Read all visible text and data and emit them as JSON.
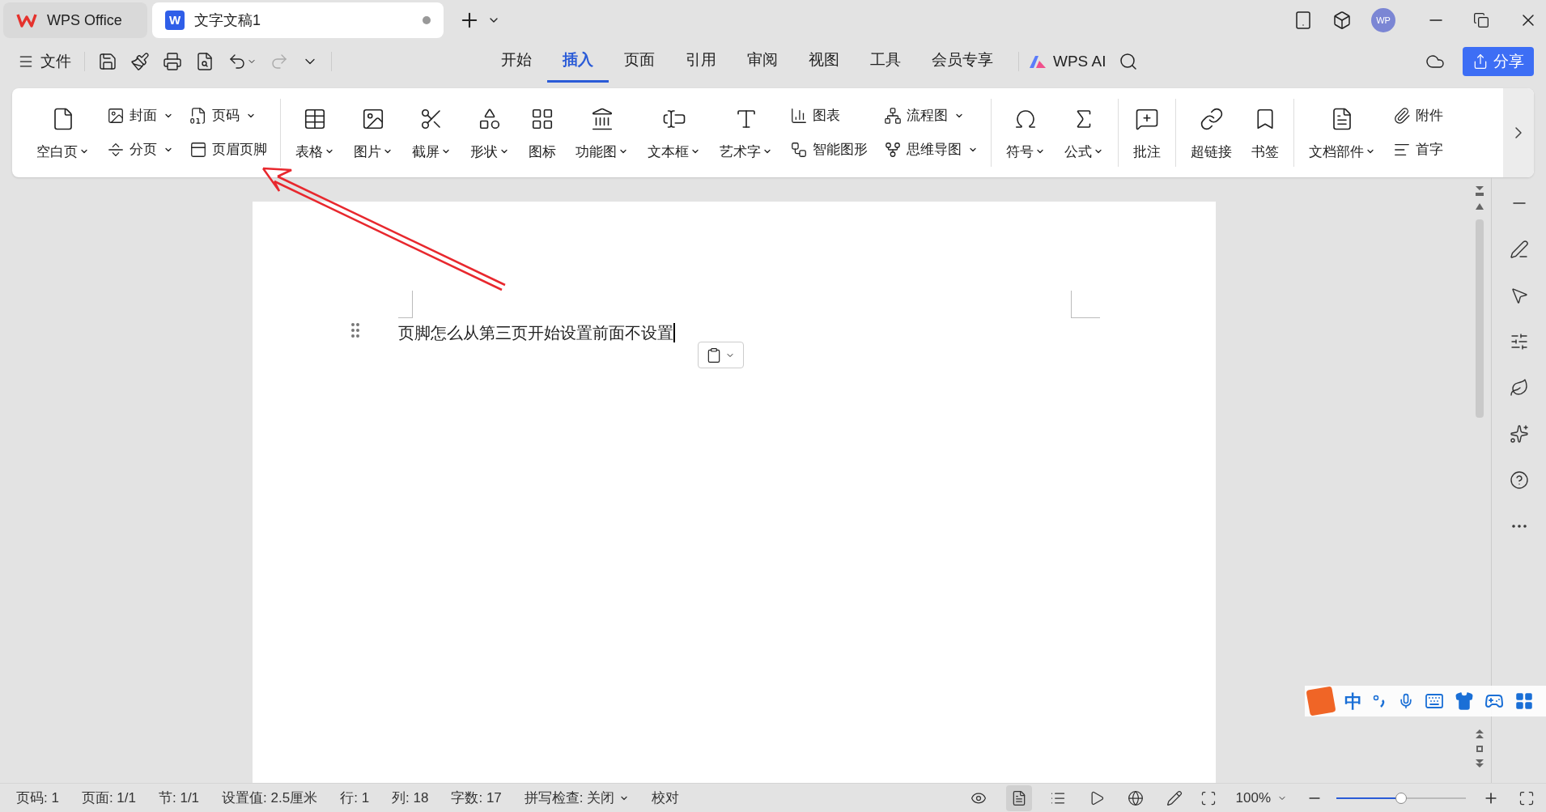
{
  "tabs": [
    {
      "label": "WPS Office",
      "selected": false,
      "kind": "home"
    },
    {
      "label": "文字文稿1",
      "selected": true,
      "kind": "document",
      "badge": "W",
      "unsaved": true
    }
  ],
  "user": {
    "initials": "WP"
  },
  "file_menu": {
    "label": "文件"
  },
  "menu_tabs": [
    {
      "label": "开始",
      "selected": false
    },
    {
      "label": "插入",
      "selected": true
    },
    {
      "label": "页面",
      "selected": false
    },
    {
      "label": "引用",
      "selected": false
    },
    {
      "label": "审阅",
      "selected": false
    },
    {
      "label": "视图",
      "selected": false
    },
    {
      "label": "工具",
      "selected": false
    },
    {
      "label": "会员专享",
      "selected": false
    }
  ],
  "ai": {
    "label": "WPS AI"
  },
  "share": {
    "label": "分享"
  },
  "ribbon": {
    "groups": [
      [
        {
          "kind": "large",
          "label": "空白页",
          "dropdown": true
        },
        {
          "kind": "stack",
          "items": [
            {
              "label": "封面",
              "dropdown": true
            },
            {
              "label": "分页",
              "dropdown": true
            }
          ]
        },
        {
          "kind": "stack",
          "items": [
            {
              "label": "页码",
              "dropdown": true
            },
            {
              "label": "页眉页脚",
              "dropdown": false
            }
          ]
        }
      ],
      [
        {
          "kind": "large",
          "label": "表格",
          "dropdown": true
        },
        {
          "kind": "large",
          "label": "图片",
          "dropdown": true
        },
        {
          "kind": "large",
          "label": "截屏",
          "dropdown": true
        },
        {
          "kind": "large",
          "label": "形状",
          "dropdown": true
        },
        {
          "kind": "large",
          "label": "图标",
          "dropdown": false
        },
        {
          "kind": "large",
          "label": "功能图",
          "dropdown": true
        },
        {
          "kind": "large",
          "label": "文本框",
          "dropdown": true
        },
        {
          "kind": "large",
          "label": "艺术字",
          "dropdown": true
        },
        {
          "kind": "stack",
          "items": [
            {
              "label": "图表",
              "dropdown": false
            },
            {
              "label": "智能图形",
              "dropdown": false
            }
          ]
        },
        {
          "kind": "stack",
          "items": [
            {
              "label": "流程图",
              "dropdown": true
            },
            {
              "label": "思维导图",
              "dropdown": true
            }
          ]
        }
      ],
      [
        {
          "kind": "large",
          "label": "符号",
          "dropdown": true
        },
        {
          "kind": "large",
          "label": "公式",
          "dropdown": true
        }
      ],
      [
        {
          "kind": "large",
          "label": "批注",
          "dropdown": false
        }
      ],
      [
        {
          "kind": "large",
          "label": "超链接",
          "dropdown": false
        },
        {
          "kind": "large",
          "label": "书签",
          "dropdown": false
        }
      ],
      [
        {
          "kind": "large",
          "label": "文档部件",
          "dropdown": true
        },
        {
          "kind": "stack",
          "items": [
            {
              "label": "附件",
              "dropdown": false
            },
            {
              "label": "首字",
              "dropdown": false
            }
          ]
        }
      ]
    ]
  },
  "document": {
    "text": "页脚怎么从第三页开始设置前面不设置"
  },
  "annotation": {
    "kind": "arrow"
  },
  "ime": {
    "mode": "中"
  },
  "status_bar": {
    "items": [
      {
        "label": "页码: 1",
        "dropdown": false
      },
      {
        "label": "页面: 1/1",
        "dropdown": false
      },
      {
        "label": "节: 1/1",
        "dropdown": false
      },
      {
        "label": "设置值: 2.5厘米",
        "dropdown": false
      },
      {
        "label": "行: 1",
        "dropdown": false
      },
      {
        "label": "列: 18",
        "dropdown": false
      },
      {
        "label": "字数: 17",
        "dropdown": false
      },
      {
        "label": "拼写检查: 关闭",
        "dropdown": true
      },
      {
        "label": "校对",
        "dropdown": false
      }
    ],
    "view_modes": [
      {
        "selected": true
      },
      {
        "selected": false
      },
      {
        "selected": false
      },
      {
        "selected": false
      },
      {
        "selected": false
      }
    ],
    "zoom": {
      "label": "100%",
      "level": 0.5
    }
  }
}
